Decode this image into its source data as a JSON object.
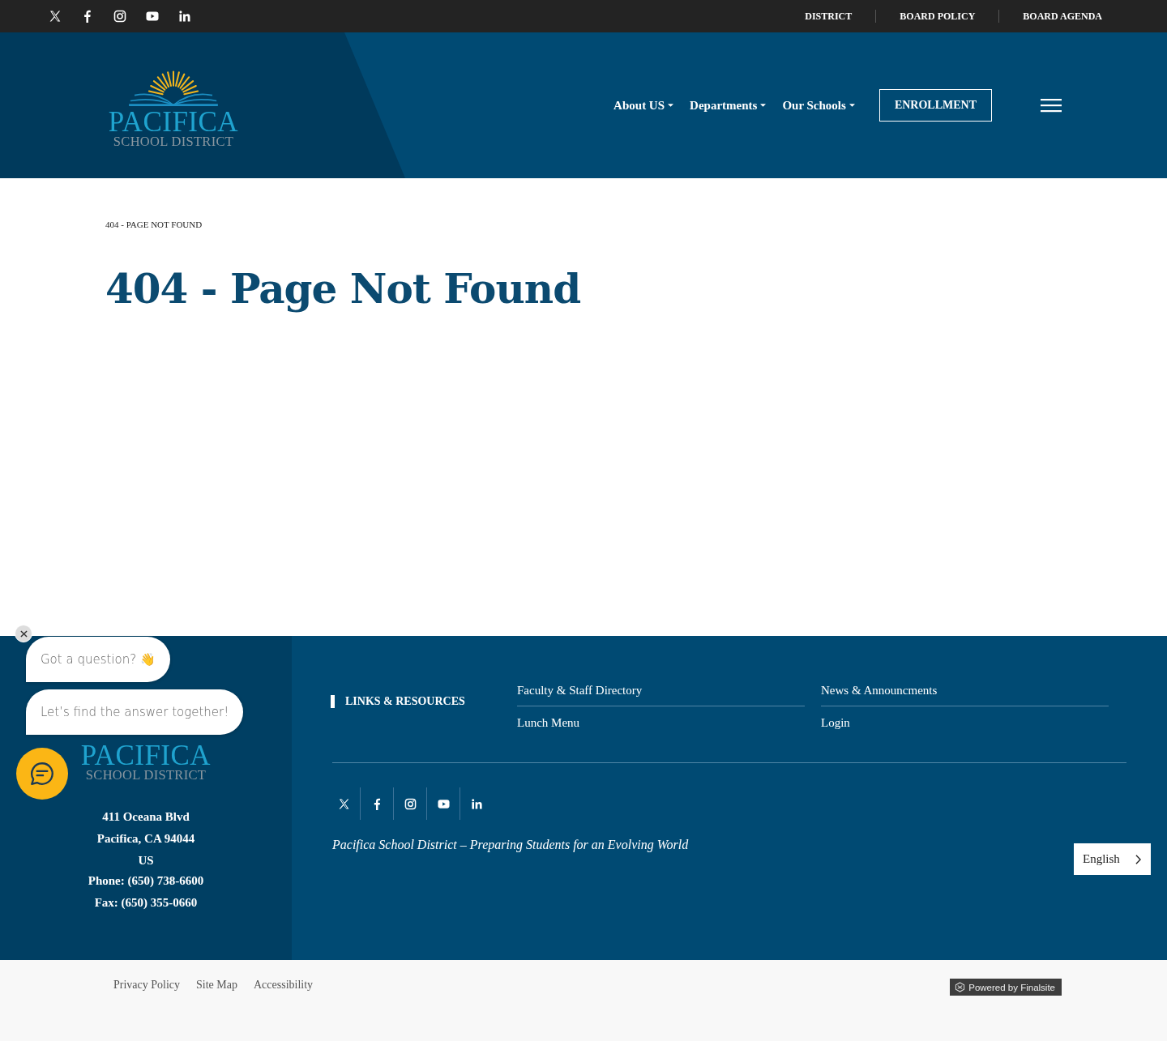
{
  "top_bar": {
    "links": [
      "DISTRICT",
      "BOARD POLICY",
      "BOARD AGENDA"
    ]
  },
  "header": {
    "logo": {
      "name": "PACIFICA",
      "subtitle": "SCHOOL DISTRICT"
    },
    "nav": [
      {
        "label": "About US",
        "kind": "dropdown"
      },
      {
        "label": "Departments",
        "kind": "dropdown"
      },
      {
        "label": "Our Schools",
        "kind": "dropdown"
      },
      {
        "label": "ENROLLMENT",
        "kind": "button"
      }
    ]
  },
  "main": {
    "breadcrumb": "404 - PAGE NOT FOUND",
    "title": "404 - Page Not Found"
  },
  "footer": {
    "logo": {
      "name": "PACIFICA",
      "subtitle": "SCHOOL DISTRICT"
    },
    "address": [
      "411 Oceana Blvd",
      "Pacifica, CA  94044",
      "US",
      "Phone: (650) 738-6600",
      "Fax: (650) 355-0660"
    ],
    "links_heading": "LINKS & RESOURCES",
    "links": [
      "Faculty & Staff Directory",
      "News & Announcments",
      "Lunch Menu",
      "Login"
    ],
    "tagline": "Pacifica School District – Preparing Students for an Evolving World",
    "language": "English"
  },
  "bottom_bar": {
    "links": [
      "Privacy Policy",
      "Site Map",
      "Accessibility"
    ],
    "powered_by": "Powered by Finalsite"
  },
  "chat": {
    "bubbles": [
      "Got a question? 👋",
      "Let’s find the answer together!"
    ]
  }
}
